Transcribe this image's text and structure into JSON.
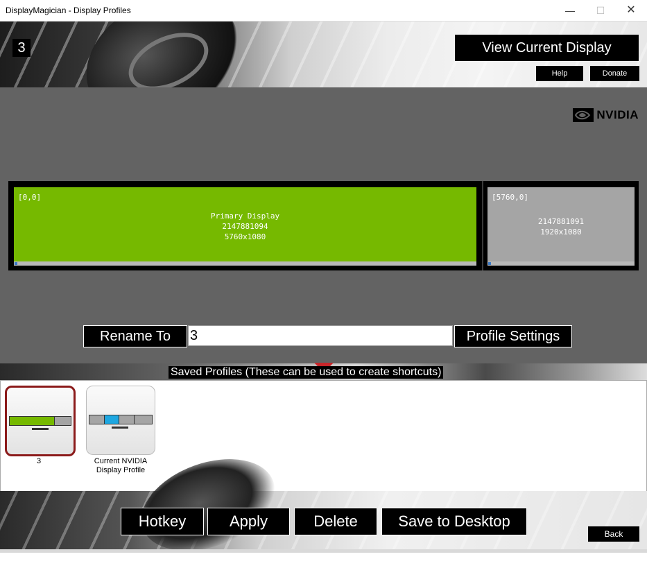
{
  "window": {
    "title": "DisplayMagician - Display Profiles",
    "minimize_label": "—",
    "maximize_label": "☐",
    "close_label": "✕"
  },
  "header": {
    "profile_name": "3",
    "view_current_label": "View Current Display",
    "help_label": "Help",
    "donate_label": "Donate"
  },
  "display_area": {
    "vendor_logo_text": "NVIDIA",
    "displays": [
      {
        "coord": "[0,0]",
        "line1": "Primary Display",
        "line2": "2147881094",
        "line3": "5760x1080",
        "color": "#76b900"
      },
      {
        "coord": "[5760,0]",
        "line1": "2147881091",
        "line2": "1920x1080",
        "color": "#a5a5a5"
      }
    ]
  },
  "rename": {
    "button_label": "Rename To",
    "input_value": "3",
    "settings_label": "Profile Settings"
  },
  "saved_profiles": {
    "header": "Saved Profiles (These can be used to create shortcuts)",
    "items": [
      {
        "label": "3",
        "selected": true
      },
      {
        "label_line1": "Current NVIDIA",
        "label_line2": "Display Profile",
        "selected": false
      }
    ]
  },
  "footer": {
    "hotkey_label": "Hotkey",
    "apply_label": "Apply",
    "delete_label": "Delete",
    "save_desktop_label": "Save to Desktop",
    "back_label": "Back"
  },
  "colors": {
    "nvidia_green": "#76b900",
    "selected_border": "#8b1a1a",
    "arrow_red": "#c8262a",
    "secondary_display": "#a5a5a5",
    "highlight_blue": "#1ea7e1"
  }
}
